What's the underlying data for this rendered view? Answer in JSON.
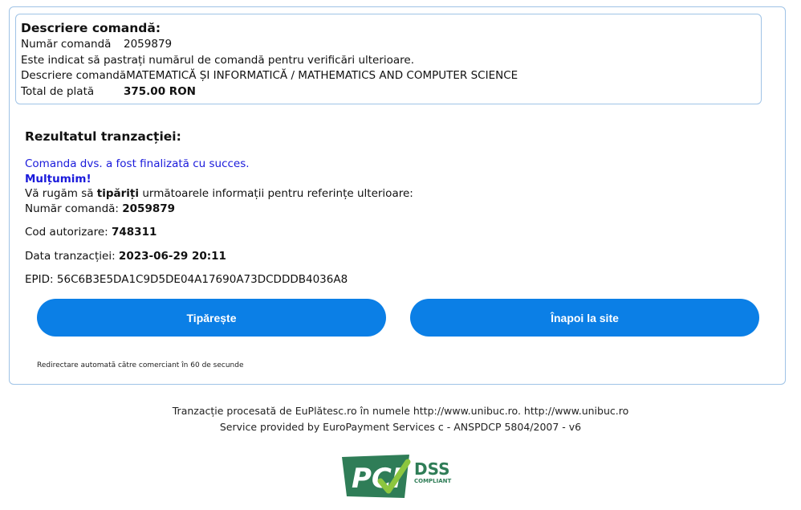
{
  "order": {
    "title": "Descriere comandă:",
    "number_label": "Număr comandă",
    "number_value": "2059879",
    "note": "Este indicat să pastrați numărul de comandă pentru verificări ulterioare.",
    "desc_label": "Descriere comandă",
    "desc_value": "MATEMATICĂ ȘI INFORMATICĂ / MATHEMATICS AND COMPUTER SCIENCE",
    "total_label": "Total de plată",
    "total_value": "375.00 RON"
  },
  "result": {
    "title": "Rezultatul tranzacției:",
    "success": "Comanda dvs. a fost finalizată cu succes.",
    "thanks": "Mulțumim!",
    "print_prefix": "Vă rugăm să ",
    "print_bold": "tipăriți",
    "print_suffix": " următoarele informații pentru referințe ulterioare:",
    "order_label": "Număr comandă: ",
    "order_value": "2059879",
    "auth_label": "Cod autorizare: ",
    "auth_value": "748311",
    "date_label": "Data tranzacției: ",
    "date_value": "2023-06-29 20:11",
    "epid_label": "EPID: ",
    "epid_value": "56C6B3E5DA1C9D5DE04A17690A73DCDDDB4036A8"
  },
  "buttons": {
    "print": "Tipărește",
    "back": "Înapoi la site"
  },
  "redirect": "Redirectare automată către comerciant în 60 de secunde",
  "footer": {
    "line1": "Tranzacție procesată de EuPlătesc.ro în numele http://www.unibuc.ro. http://www.unibuc.ro",
    "line2": "Service provided by EuroPayment Services c - ANSPDCP 5804/2007 - v6"
  },
  "logo": {
    "pci": "PCI",
    "dss": "DSS",
    "compliant": "COMPLIANT"
  },
  "colors": {
    "button": "#0b7fe6",
    "border": "#9fc3e6",
    "success_text": "#1a1adb",
    "pci_green": "#2f7d57"
  }
}
